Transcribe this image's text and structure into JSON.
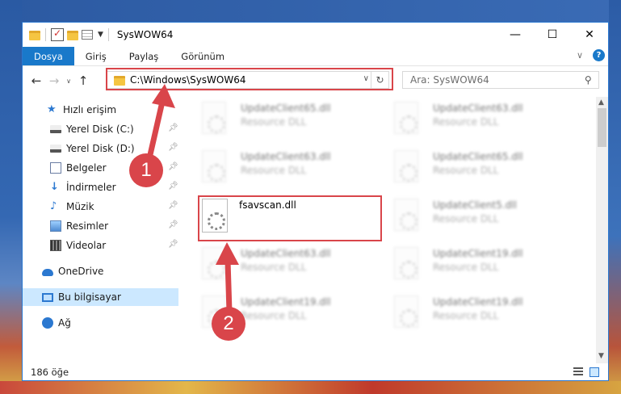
{
  "window": {
    "title": "SysWOW64",
    "controls": {
      "minimize": "—",
      "maximize": "☐",
      "close": "✕"
    }
  },
  "ribbon": {
    "tabs": [
      "Dosya",
      "Giriş",
      "Paylaş",
      "Görünüm"
    ],
    "help": "?"
  },
  "nav": {
    "back": "←",
    "forward": "→",
    "recent": "∨",
    "up": "↑",
    "address": "C:\\Windows\\SysWOW64",
    "search_placeholder": "Ara: SysWOW64"
  },
  "sidebar": {
    "items": [
      {
        "label": "Hızlı erişim",
        "icon": "star-icon",
        "pinned": false
      },
      {
        "label": "Yerel Disk (C:)",
        "icon": "disk-icon",
        "pinned": true
      },
      {
        "label": "Yerel Disk (D:)",
        "icon": "disk-icon",
        "pinned": true
      },
      {
        "label": "Belgeler",
        "icon": "document-icon",
        "pinned": true
      },
      {
        "label": "İndirmeler",
        "icon": "download-icon",
        "pinned": true
      },
      {
        "label": "Müzik",
        "icon": "music-icon",
        "pinned": true
      },
      {
        "label": "Resimler",
        "icon": "pictures-icon",
        "pinned": true
      },
      {
        "label": "Videolar",
        "icon": "video-icon",
        "pinned": true
      },
      {
        "label": "OneDrive",
        "icon": "cloud-icon",
        "pinned": false
      },
      {
        "label": "Bu bilgisayar",
        "icon": "computer-icon",
        "pinned": false,
        "selected": true
      },
      {
        "label": "Ağ",
        "icon": "network-icon",
        "pinned": false
      }
    ]
  },
  "files": {
    "left": [
      {
        "name": "UpdateClient65.dll",
        "desc": "Resource DLL",
        "blurred": true
      },
      {
        "name": "UpdateClient63.dll",
        "desc": "Resource DLL",
        "blurred": true
      },
      {
        "name": "fsavscan.dll",
        "desc": "",
        "blurred": false
      },
      {
        "name": "UpdateClient63.dll",
        "desc": "Resource DLL",
        "blurred": true
      },
      {
        "name": "UpdateClient19.dll",
        "desc": "Resource DLL",
        "blurred": true
      }
    ],
    "right": [
      {
        "name": "UpdateClient63.dll",
        "desc": "Resource DLL",
        "blurred": true
      },
      {
        "name": "UpdateClient65.dll",
        "desc": "Resource DLL",
        "blurred": true
      },
      {
        "name": "UpdateClient5.dll",
        "desc": "Resource DLL",
        "blurred": true
      },
      {
        "name": "UpdateClient19.dll",
        "desc": "Resource DLL",
        "blurred": true
      },
      {
        "name": "UpdateClient19.dll",
        "desc": "Resource DLL",
        "blurred": true
      }
    ]
  },
  "status": {
    "count": "186 öğe"
  },
  "annotations": {
    "badge1": "1",
    "badge2": "2",
    "color": "#d9454a"
  }
}
